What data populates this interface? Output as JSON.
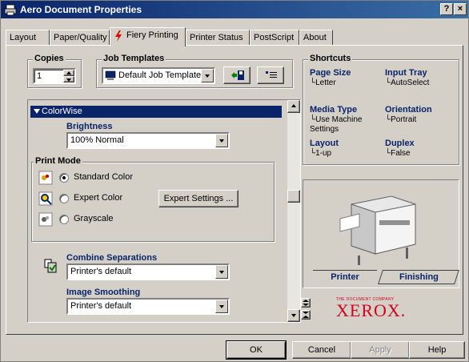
{
  "window": {
    "title": "Aero Document Properties",
    "help_btn": "?",
    "close_btn": "×"
  },
  "tabs": [
    {
      "label": "Layout"
    },
    {
      "label": "Paper/Quality"
    },
    {
      "label": "Fiery Printing"
    },
    {
      "label": "Printer Status"
    },
    {
      "label": "PostScript"
    },
    {
      "label": "About"
    }
  ],
  "copies": {
    "legend": "Copies",
    "value": "1"
  },
  "job_templates": {
    "legend": "Job Templates",
    "selected": "Default Job Templates"
  },
  "shortcuts": {
    "legend": "Shortcuts",
    "items": [
      {
        "label": "Page Size",
        "value": "Letter"
      },
      {
        "label": "Input Tray",
        "value": "AutoSelect"
      },
      {
        "label": "Media Type",
        "value": "Use Machine Settings"
      },
      {
        "label": "Orientation",
        "value": "Portrait"
      },
      {
        "label": "Layout",
        "value": "1-up"
      },
      {
        "label": "Duplex",
        "value": "False"
      }
    ]
  },
  "colorwise": {
    "header": "ColorWise",
    "brightness_label": "Brightness",
    "brightness_value": "100% Normal",
    "print_mode_legend": "Print Mode",
    "modes": [
      {
        "label": "Standard Color",
        "selected": true
      },
      {
        "label": "Expert Color",
        "selected": false
      },
      {
        "label": "Grayscale",
        "selected": false
      }
    ],
    "expert_settings_button": "Expert Settings ...",
    "combine_label": "Combine Separations",
    "combine_value": "Printer's default",
    "smoothing_label": "Image Smoothing",
    "smoothing_value": "Printer's default"
  },
  "preview": {
    "printer_tab": "Printer",
    "finishing_tab": "Finishing"
  },
  "brand": {
    "company_line": "THE DOCUMENT COMPANY",
    "name": "XEROX."
  },
  "buttons": {
    "ok": "OK",
    "cancel": "Cancel",
    "apply": "Apply",
    "help": "Help"
  },
  "colors": {
    "accent": "#0a246a",
    "xerox_red": "#d2001e",
    "face": "#d4d0c8"
  }
}
